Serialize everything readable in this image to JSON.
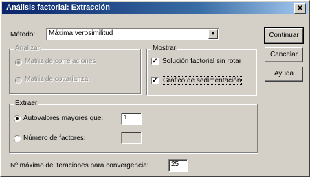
{
  "window": {
    "title": "Análisis factorial: Extracción",
    "close_icon": "close-icon"
  },
  "method": {
    "label": "Método:",
    "value": "Máxima verosimilitud"
  },
  "analyze_group": {
    "legend": "Analizar",
    "options": [
      "Matriz de correlaciones",
      "Matriz de covarianza"
    ],
    "selected_index": 0
  },
  "display_group": {
    "legend": "Mostrar",
    "unrotated": {
      "label": "Solución factorial sin rotar",
      "checked": true
    },
    "scree": {
      "label": "Gráfico de sedimentación",
      "checked": true
    }
  },
  "extract_group": {
    "legend": "Extraer",
    "eigen": {
      "label": "Autovalores mayores que:",
      "value": "1",
      "selected": true
    },
    "nfactors": {
      "label": "Número de factores:",
      "value": "",
      "selected": false
    }
  },
  "iterations": {
    "label": "Nº máximo de iteraciones para convergencia:",
    "value": "25"
  },
  "buttons": {
    "continue": "Continuar",
    "cancel": "Cancelar",
    "help": "Ayuda"
  }
}
